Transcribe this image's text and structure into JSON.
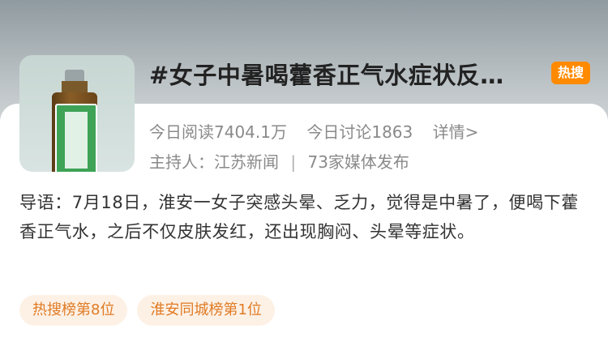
{
  "topic": {
    "title": "#女子中暑喝藿香正气水症状反…",
    "badge": "热搜",
    "reads": "今日阅读7404.1万",
    "discussions": "今日讨论1863",
    "detail_link": "详情>",
    "host": "主持人：江苏新闻",
    "separator": "|",
    "media": "73家媒体发布",
    "cover_icon": "medicine-bottle-image"
  },
  "intro": {
    "text": "导语：7月18日，淮安一女子突感头晕、乏力，觉得是中暑了，便喝下藿香正气水，之后不仅皮肤发红，还出现胸闷、头晕等症状。"
  },
  "tags": [
    {
      "label": "热搜榜第8位"
    },
    {
      "label": "淮安同城榜第1位"
    }
  ],
  "colors": {
    "badge_bg": "#ff8a00",
    "tag_bg": "#fdf1e6",
    "tag_text": "#e07b24"
  }
}
